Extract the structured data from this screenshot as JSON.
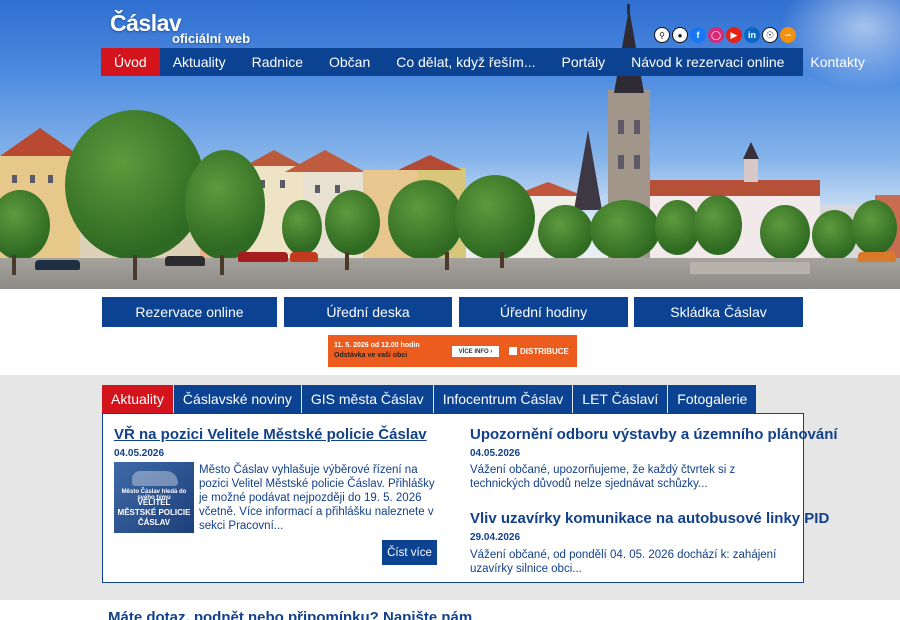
{
  "header": {
    "logo": "Čáslav",
    "subtitle": "oficiální web",
    "social_icons": [
      "search-icon",
      "accessibility-icon",
      "facebook-icon",
      "instagram-icon",
      "youtube-icon",
      "linkedin-icon",
      "broadcast-icon",
      "rss-icon"
    ]
  },
  "nav": {
    "items": [
      "Úvod",
      "Aktuality",
      "Radnice",
      "Občan",
      "Co dělat, když řeším...",
      "Portály",
      "Návod k rezervaci online",
      "Kontakty"
    ],
    "active": "Úvod"
  },
  "quick_links": [
    "Rezervace online",
    "Úřední deska",
    "Úřední hodiny",
    "Skládka Čáslav"
  ],
  "banner": {
    "line1": "11. 5. 2026 od 12.00 hodin",
    "line2": "Odstávka ve vaší obci",
    "button": "VÍCE INFO  ›",
    "brand": "DISTRIBUCE"
  },
  "tabs": {
    "items": [
      "Aktuality",
      "Čáslavské noviny",
      "GIS města Čáslav",
      "Infocentrum Čáslav",
      "LET Čáslaví",
      "Fotogalerie"
    ],
    "active": "Aktuality"
  },
  "articles": {
    "main": {
      "title": "VŘ na pozici Velitele Městské policie Čáslav",
      "date": "04.05.2026",
      "text": "Město Čáslav vyhlašuje výběrové řízení na pozici Velitel Městské policie Čáslav.  Přihlášky  je možné podávat nejpozději do 19. 5. 2026 včetně. Více informací a přihlášku naleznete v sekci Pracovní...",
      "thumb_line1": "Město Čáslav hledá do svého týmu",
      "thumb_line2": "VELITEL\nMĚSTSKÉ POLICIE\nČÁSLAV",
      "read_more": "Číst více"
    },
    "side": [
      {
        "title": "Upozornění odboru výstavby a územního plánování",
        "date": "04.05.2026",
        "text": "Vážení občané, upozorňujeme, že každý čtvrtek si z technických důvodů nelze sjednávat schůzky..."
      },
      {
        "title": "Vliv uzavírky komunikace na autobusové linky PID",
        "date": "29.04.2026",
        "text": "Vážení občané, od pondělí  04. 05. 2026  dochází k: zahájení uzavírky silnice obci..."
      }
    ]
  },
  "footer": {
    "question": "Máte dotaz, podnět nebo připomínku? Napište nám"
  },
  "colors": {
    "primary": "#0b4291",
    "accent": "#d4141d",
    "banner": "#ec5c1e"
  }
}
